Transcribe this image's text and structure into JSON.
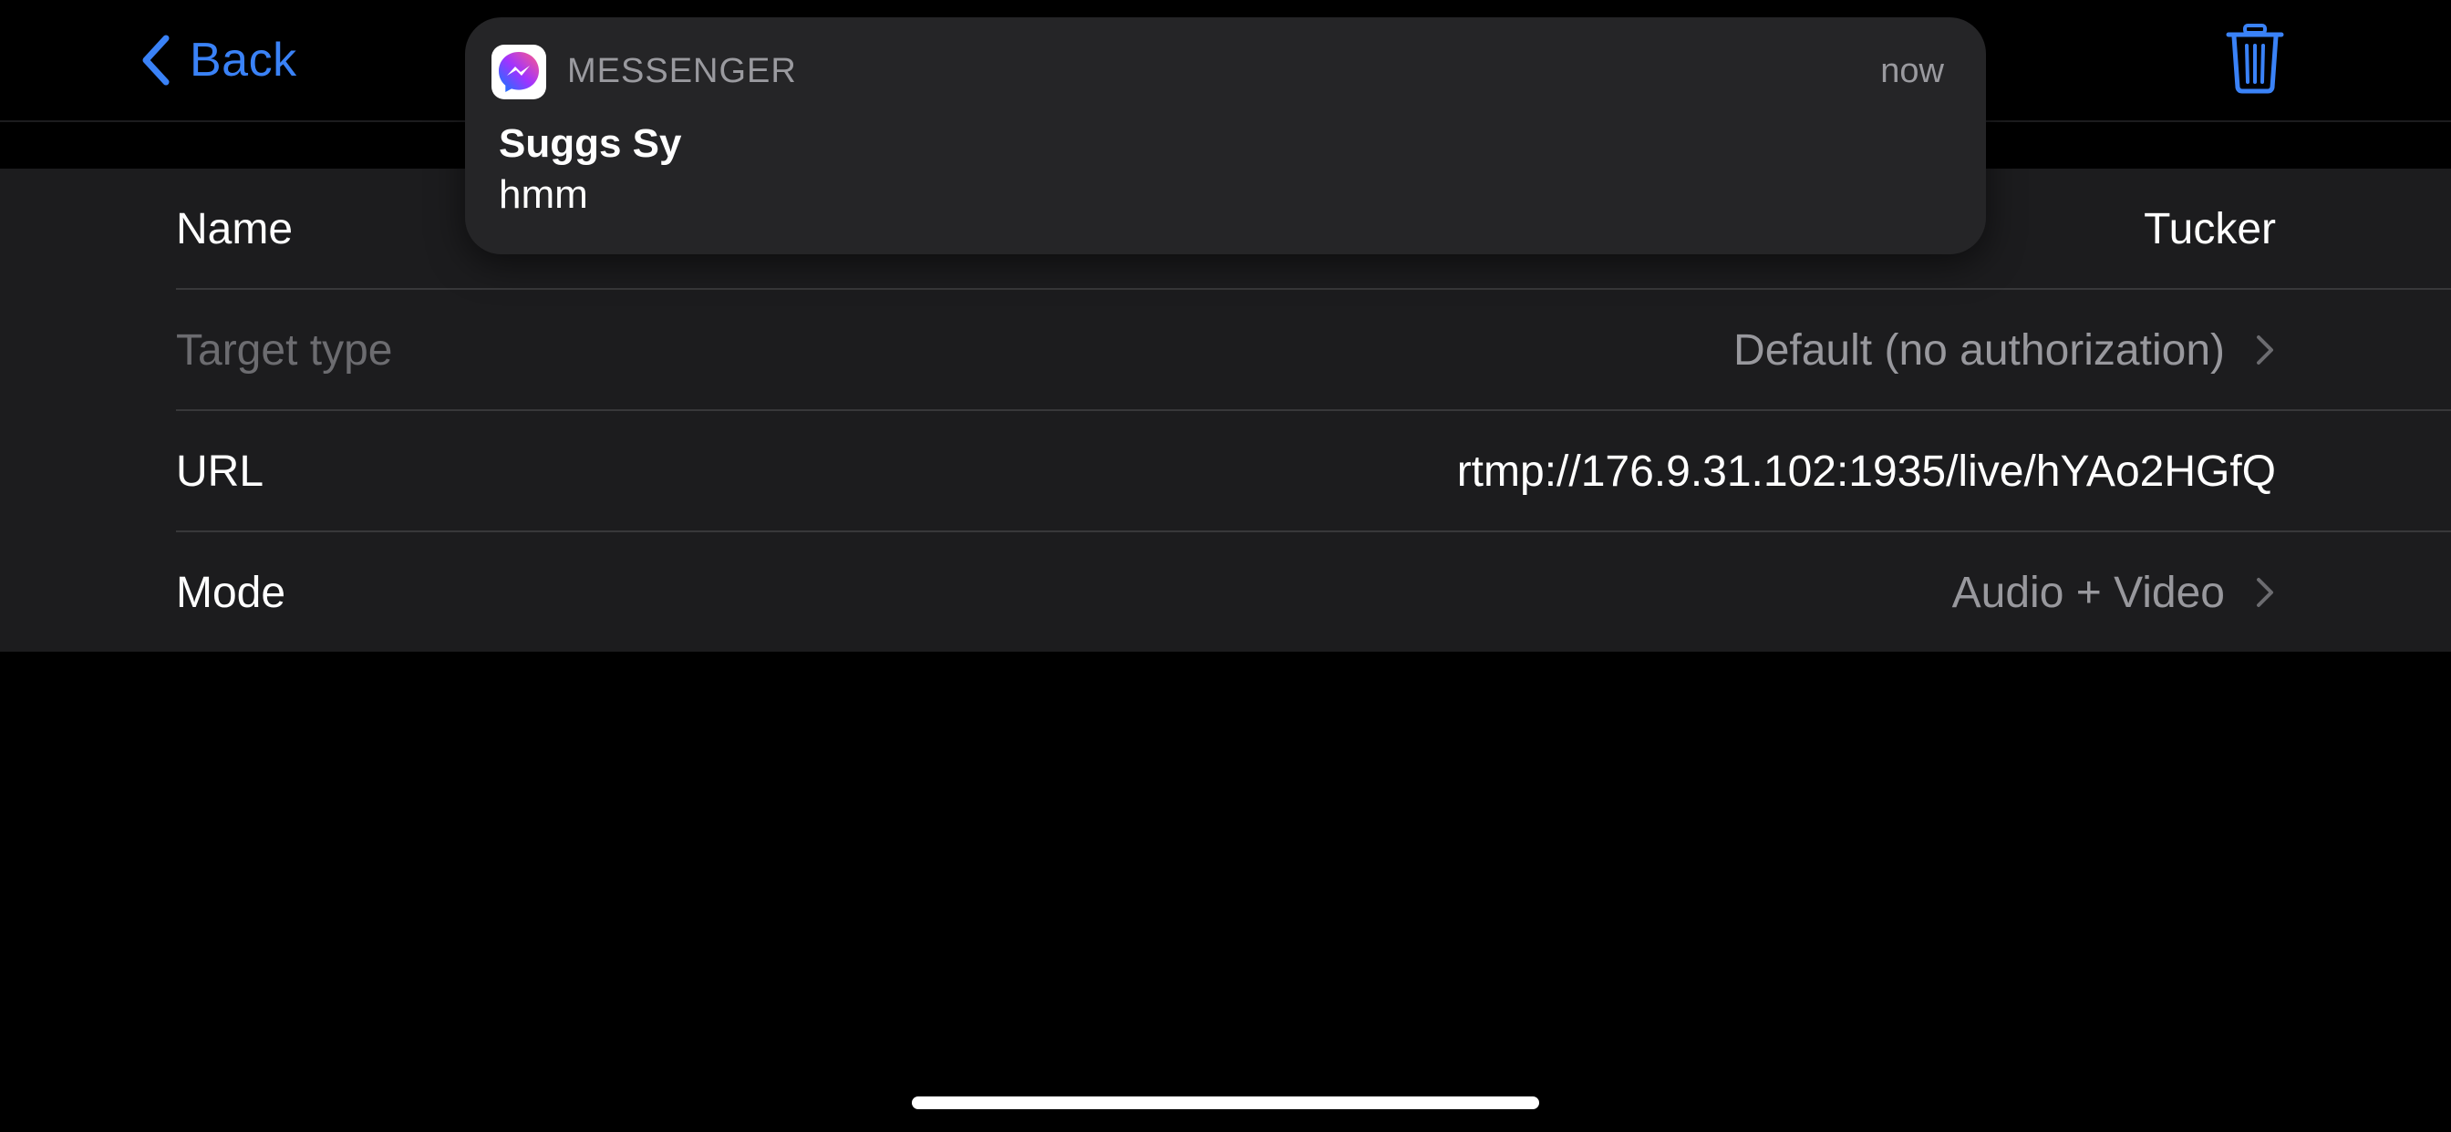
{
  "navbar": {
    "back_label": "Back",
    "back_icon": "chevron-left-icon",
    "trash_icon": "trash-icon",
    "accent_color": "#3a82f7"
  },
  "form": {
    "rows": [
      {
        "label": "Name",
        "value": "Tucker",
        "disabled": false,
        "disclosure": false
      },
      {
        "label": "Target type",
        "value": "Default (no authorization)",
        "disabled": true,
        "disclosure": true
      },
      {
        "label": "URL",
        "value": "rtmp://176.9.31.102:1935/live/hYAo2HGfQ",
        "disabled": false,
        "disclosure": false
      },
      {
        "label": "Mode",
        "value": "Audio + Video",
        "disabled": false,
        "disclosure": true
      }
    ]
  },
  "notification": {
    "app_icon": "messenger-icon",
    "app_name": "MESSENGER",
    "time": "now",
    "title": "Suggs Sy",
    "body": "hmm"
  }
}
